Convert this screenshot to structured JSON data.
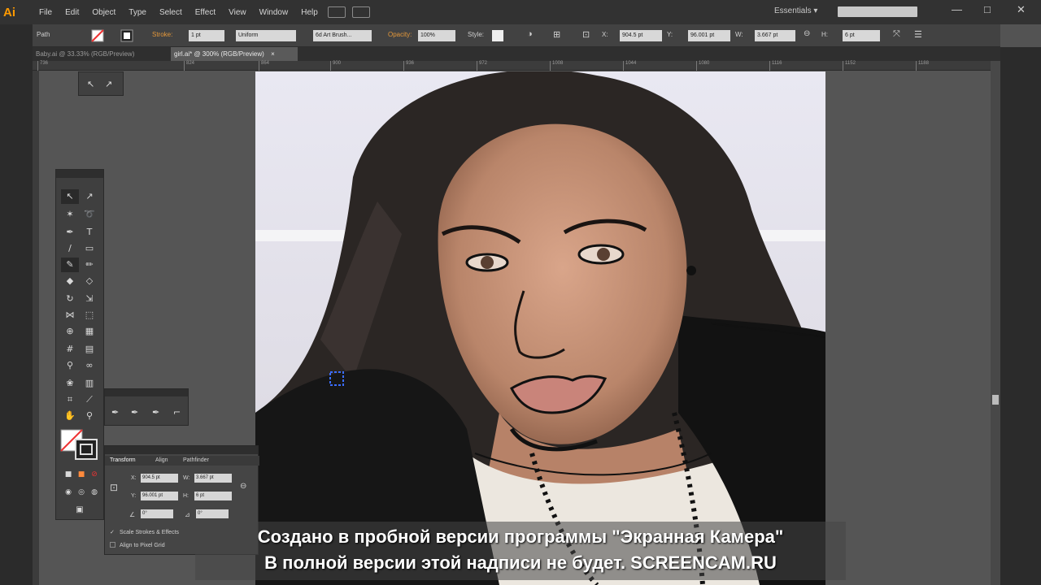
{
  "app": {
    "logo": "Ai"
  },
  "menu": [
    "File",
    "Edit",
    "Object",
    "Type",
    "Select",
    "Effect",
    "View",
    "Window",
    "Help"
  ],
  "workspace": {
    "label": "Essentials",
    "arrow": "▾"
  },
  "window_controls": {
    "minimize": "—",
    "restore": "□",
    "close": "✕"
  },
  "controlbar": {
    "object_type": "Path",
    "stroke_label": "Stroke:",
    "stroke_value": "1 pt",
    "profile": "Uniform",
    "brush": "6d Art Brush...",
    "opacity_label": "Opacity:",
    "opacity_value": "100%",
    "style_label": "Style:",
    "x_label": "X:",
    "x_value": "904.5 pt",
    "y_label": "Y:",
    "y_value": "96.001 pt",
    "w_label": "W:",
    "w_value": "3.667 pt",
    "h_label": "H:",
    "h_value": "6 pt"
  },
  "tabs": [
    {
      "label": "Baby.ai @ 33.33% (RGB/Preview)"
    },
    {
      "label": "girl.ai* @ 300% (RGB/Preview)",
      "close": "×"
    }
  ],
  "ruler_ticks": [
    "736",
    "824",
    "864",
    "900",
    "936",
    "972",
    "1008",
    "1044",
    "1080",
    "1116",
    "1152",
    "1188"
  ],
  "transform_panel": {
    "tabs": [
      "Transform",
      "Align",
      "Pathfinder"
    ],
    "x_label": "X:",
    "x_value": "904.5 pt",
    "y_label": "Y:",
    "y_value": "96.001 pt",
    "w_label": "W:",
    "w_value": "3.667 pt",
    "h_label": "H:",
    "h_value": "6 pt",
    "angle_value": "0°",
    "shear_value": "0°",
    "scale_strokes": "Scale Strokes & Effects",
    "align_pixel": "Align to Pixel Grid"
  },
  "watermark": {
    "line1": "Создано в пробной версии программы \"Экранная Камера\"",
    "line2": "В полной версии этой надписи не будет. SCREENCAM.RU"
  },
  "colors": {
    "menubar": "#323232",
    "controlbar": "#424242",
    "canvas": "#555555",
    "accent": "#e3973a"
  }
}
